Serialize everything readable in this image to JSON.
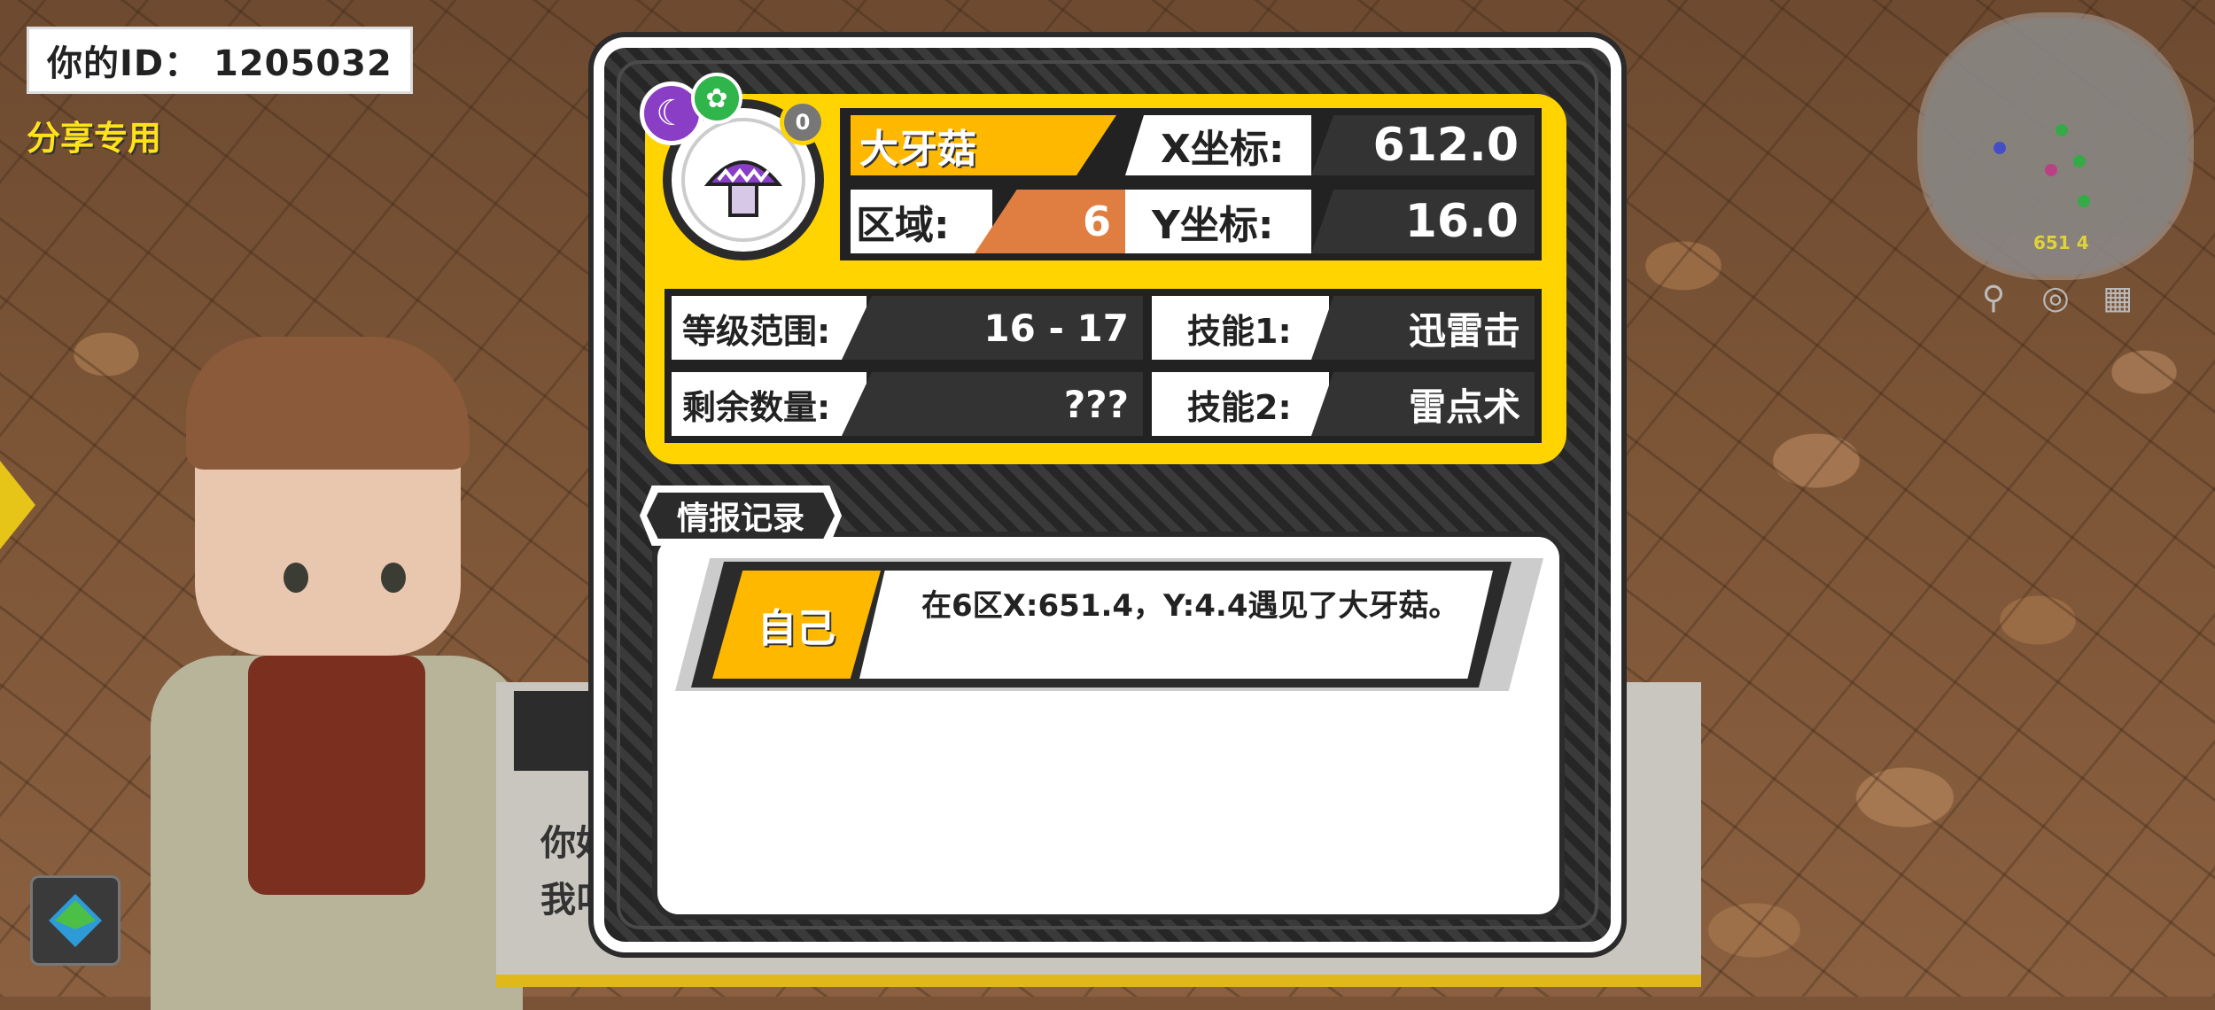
{
  "hud": {
    "player_id": "你的ID：  1205032",
    "share_label": "分享专用"
  },
  "npc_dialog": {
    "text_line1": "你好",
    "text_line2": "我叫"
  },
  "minimap": {
    "coord_text": "651 4",
    "icons": [
      "location-pin-icon",
      "target-icon",
      "map-icon"
    ]
  },
  "monster": {
    "name": "大牙菇",
    "level_badge": "0",
    "region_label": "区域:",
    "region_value": "6",
    "x_label": "X坐标:",
    "x_value": "612.0",
    "y_label": "Y坐标:",
    "y_value": "16.0",
    "level_range_label": "等级范围:",
    "level_range_value": "16 - 17",
    "remaining_label": "剩余数量:",
    "remaining_value": "???",
    "skill1_label": "技能1:",
    "skill1_value": "迅雷击",
    "skill2_label": "技能2:",
    "skill2_value": "雷点术"
  },
  "records": {
    "tab_label": "情报记录",
    "entries": [
      {
        "source": "自己",
        "text": "在6区X:651.4，Y:4.4遇见了大牙菇。"
      }
    ]
  },
  "colors": {
    "accent_yellow": "#ffd400",
    "name_orange": "#ffb800",
    "region_orange": "#e07d40",
    "panel_dark": "#2b2b2b"
  }
}
